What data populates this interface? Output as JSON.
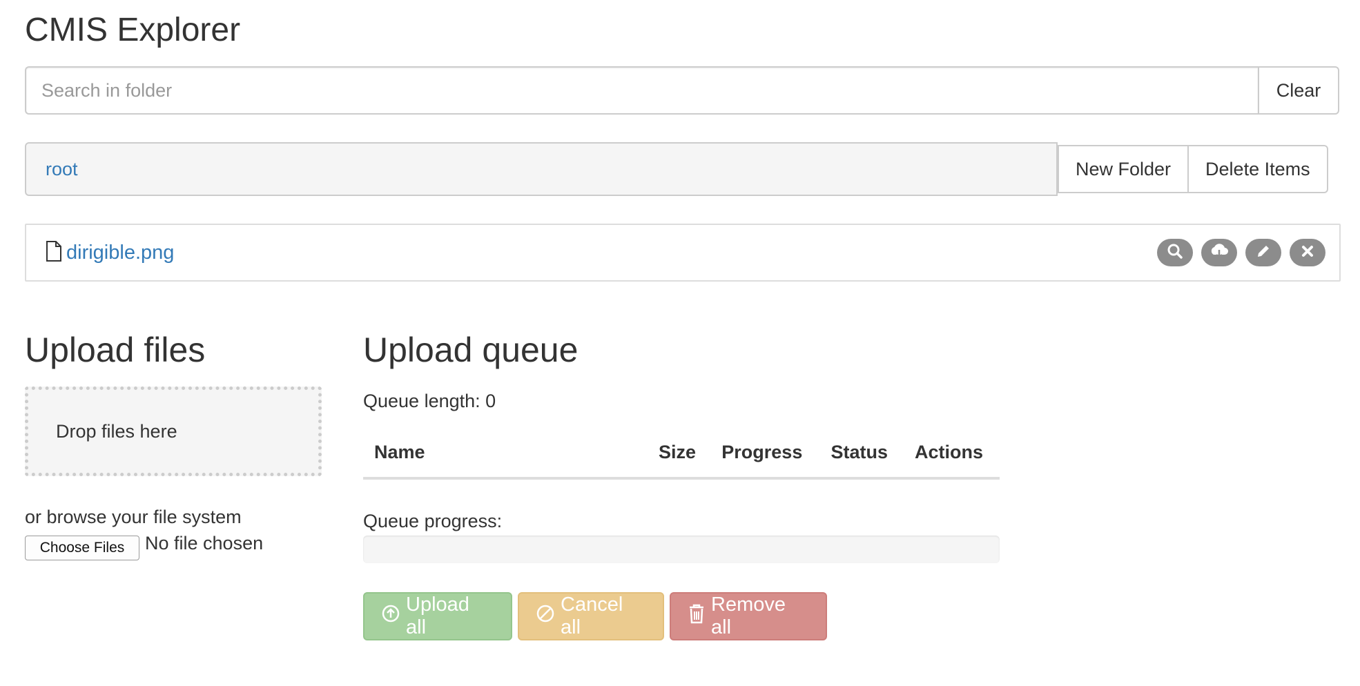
{
  "header": {
    "title": "CMIS Explorer"
  },
  "search": {
    "placeholder": "Search in folder",
    "value": "",
    "clear_label": "Clear"
  },
  "breadcrumb": {
    "items": [
      "root"
    ]
  },
  "folder_actions": {
    "new_folder_label": "New Folder",
    "delete_items_label": "Delete Items"
  },
  "files": [
    {
      "name": "dirigible.png",
      "icon": "file-icon",
      "actions": [
        "search-icon",
        "cloud-download-icon",
        "pencil-icon",
        "close-icon"
      ]
    }
  ],
  "upload_files": {
    "heading": "Upload files",
    "dropzone_text": "Drop files here",
    "browse_text": "or browse your file system",
    "choose_label": "Choose Files",
    "no_file_text": "No file chosen"
  },
  "upload_queue": {
    "heading": "Upload queue",
    "queue_length_text": "Queue length: 0",
    "columns": [
      "Name",
      "Size",
      "Progress",
      "Status",
      "Actions"
    ],
    "progress_label": "Queue progress:",
    "progress_value": 0,
    "buttons": {
      "upload_all": "Upload all",
      "cancel_all": "Cancel all",
      "remove_all": "Remove all"
    }
  },
  "colors": {
    "link": "#337ab7",
    "success": "#a6d19e",
    "warning": "#ebcb8f",
    "danger": "#d68e8b",
    "icon_button": "#8c8c8c"
  }
}
